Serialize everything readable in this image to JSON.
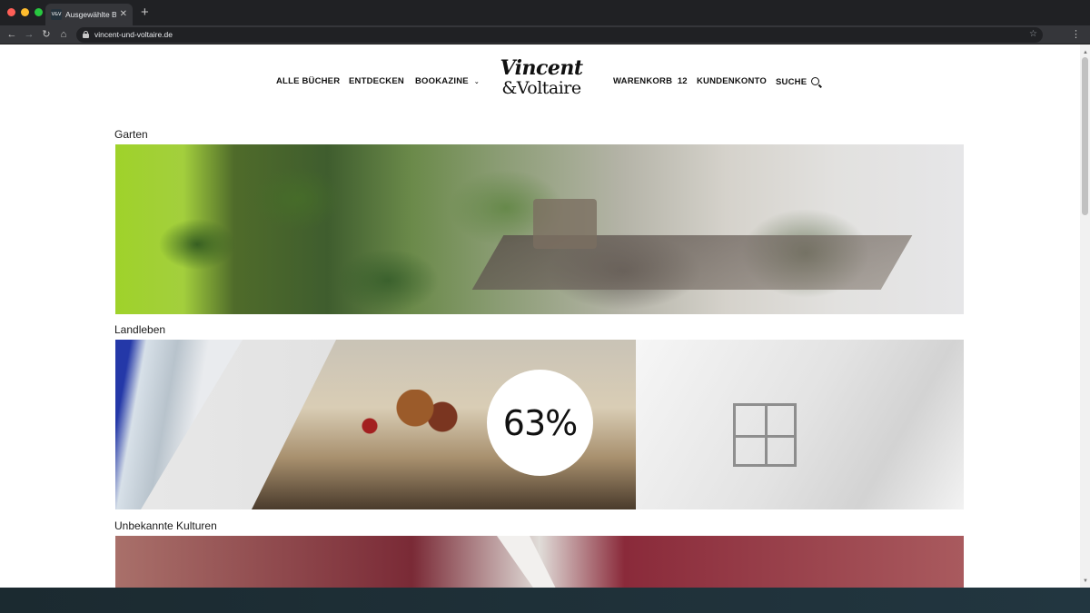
{
  "browser": {
    "tab_title": "Ausgewählte Bü",
    "favicon_text": "V&V",
    "url": "vincent-und-voltaire.de"
  },
  "nav": {
    "items": [
      {
        "label": "ALLE BÜCHER"
      },
      {
        "label": "ENTDECKEN"
      },
      {
        "label": "BOOKAZINE"
      },
      {
        "label": "WARENKORB"
      },
      {
        "label": "KUNDENKONTO"
      },
      {
        "label": "SUCHE"
      }
    ],
    "cart_count": "12",
    "logo_top": "Vincent",
    "logo_bottom": "&Voltaire"
  },
  "categories": [
    {
      "title": "Garten"
    },
    {
      "title": "Landleben"
    },
    {
      "title": "Unbekannte Kulturen"
    }
  ],
  "loading": {
    "progress_label": "63%",
    "progress": 0.63
  },
  "icons": [
    "close-icon",
    "plus-icon",
    "back-icon",
    "forward-icon",
    "reload-icon",
    "home-icon",
    "lock-icon",
    "star-icon",
    "menu-icon",
    "chevron-down-icon",
    "search-icon"
  ]
}
